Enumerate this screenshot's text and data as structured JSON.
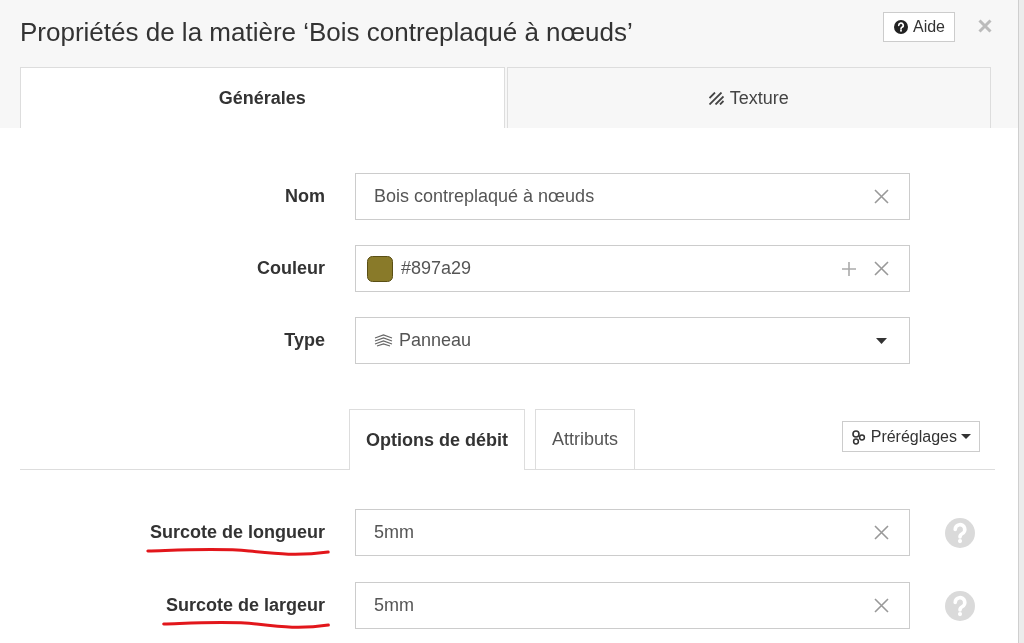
{
  "dialog": {
    "title": "Propriétés de la matière ‘Bois contreplaqué à nœuds’",
    "help_button": "Aide"
  },
  "tabs": [
    {
      "label": "Générales",
      "selected": true
    },
    {
      "label": "Texture",
      "selected": false
    }
  ],
  "fields": [
    {
      "kind": "text",
      "label": "Nom",
      "value": "Bois contreplaqué à nœuds"
    },
    {
      "kind": "color",
      "label": "Couleur",
      "value": "#897a29",
      "color": "#897a29"
    },
    {
      "kind": "select",
      "label": "Type",
      "value": "Panneau"
    }
  ],
  "sub_tabs": [
    {
      "label": "Options de débit",
      "selected": true
    },
    {
      "label": "Attributs",
      "selected": false
    }
  ],
  "presets_button": "Préréglages",
  "cut_options": [
    {
      "label": "Surcote de longueur",
      "value": "5mm",
      "underlined": true
    },
    {
      "label": "Surcote de largeur",
      "value": "5mm",
      "underlined": true
    }
  ]
}
